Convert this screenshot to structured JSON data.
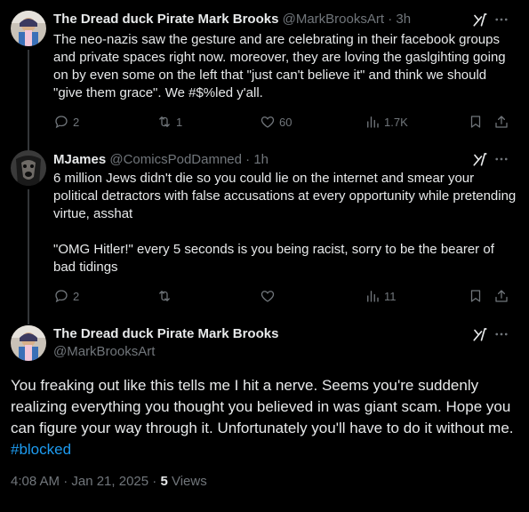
{
  "posts": [
    {
      "name": "The Dread duck Pirate Mark Brooks",
      "handle": "@MarkBrooksArt",
      "time": "3h",
      "text": "The neo-nazis saw the gesture and are celebrating in their facebook groups and private spaces right now. moreover, they are loving the gaslgihting going on by even some on the left that \"just can't believe it\" and think we should \"give them grace\". We #$%led y'all.",
      "replies": "2",
      "reposts": "1",
      "likes": "60",
      "views": "1.7K"
    },
    {
      "name": "MJames",
      "handle": "@ComicsPodDamned",
      "time": "1h",
      "text": "6 million Jews didn't die so you could lie on the internet and smear your political detractors with false accusations at every opportunity while pretending virtue, asshat\n\n\"OMG Hitler!\" every 5 seconds is you being racist, sorry to be the bearer of bad tidings",
      "replies": "2",
      "reposts": "",
      "likes": "",
      "views": "11"
    }
  ],
  "main_post": {
    "name": "The Dread duck Pirate Mark Brooks",
    "handle": "@MarkBrooksArt",
    "text": "You freaking out like this tells me I hit a nerve. Seems you're suddenly realizing everything you thought you believed in was giant scam. Hope you can figure your way through it. Unfortunately you'll have to do it without me. ",
    "hashtag": "#blocked",
    "timestamp": "4:08 AM · Jan 21, 2025",
    "views_count": "5",
    "views_label": "Views"
  },
  "separator": "·",
  "colors": {
    "background": "#000000",
    "text": "#e7e9ea",
    "secondary": "#71767b",
    "accent": "#1d9bf0",
    "thread_line": "#333639"
  },
  "icons": [
    "grok-icon",
    "more-icon",
    "reply-icon",
    "repost-icon",
    "like-icon",
    "views-icon",
    "bookmark-icon",
    "share-icon"
  ]
}
